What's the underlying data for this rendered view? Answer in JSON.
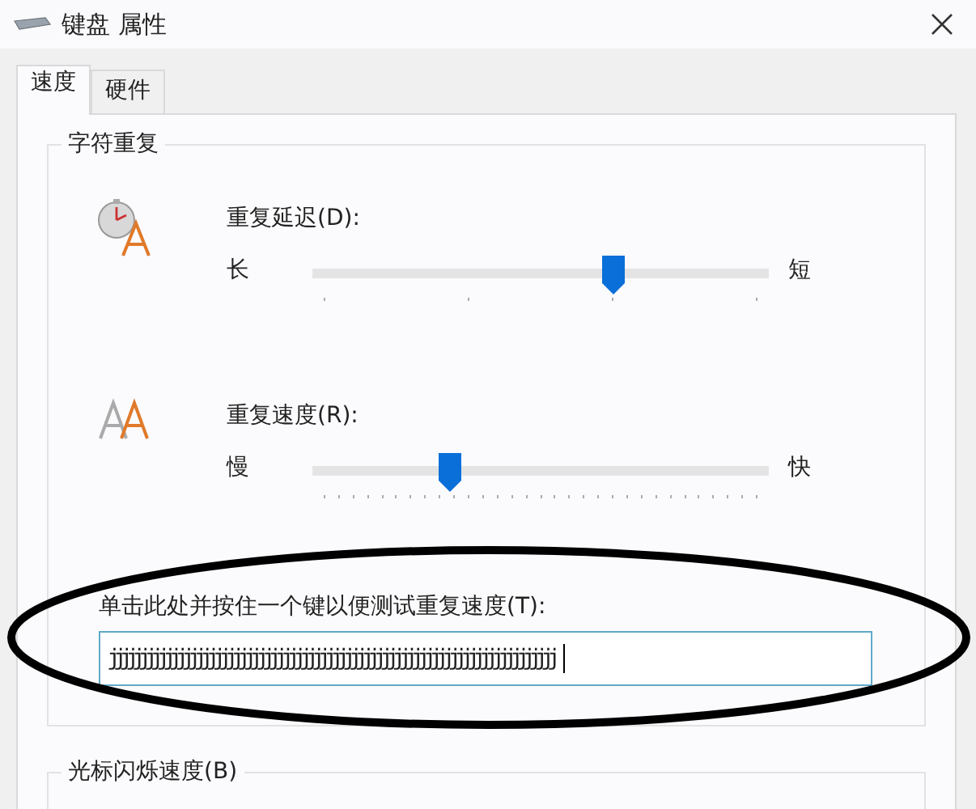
{
  "window": {
    "title": "键盘 属性"
  },
  "tabs": [
    {
      "label": "速度",
      "selected": true
    },
    {
      "label": "硬件",
      "selected": false
    }
  ],
  "repeat_group": {
    "title": "字符重复",
    "sliders": [
      {
        "kind": "coarse",
        "label": "重复延迟(D):",
        "min_label": "长",
        "max_label": "短",
        "level": 0.66
      },
      {
        "kind": "fine",
        "label": "重复速度(R):",
        "min_label": "慢",
        "max_label": "快",
        "level": 0.3
      }
    ],
    "test_field": {
      "label": "单击此处并按住一个键以便测试重复速度(T):",
      "value": "jjjjjjjjjjjjjjjjjjjjjjjjjjjjjjjjjjjjjjjjjjjjjjjjjjjjjjjjjjjjjjjjjjjjjjjj"
    }
  },
  "cursor_group": {
    "title": "光标闪烁速度(B)"
  },
  "annotation": {
    "kind": "ellipse"
  }
}
